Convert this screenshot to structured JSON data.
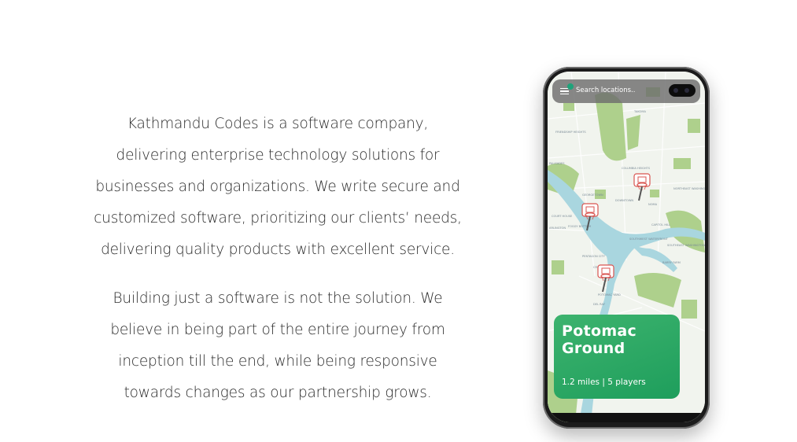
{
  "about": {
    "paragraph_1": "Kathmandu Codes is a software company, delivering enterprise technology solutions for businesses and organizations. We write secure and customized software, prioritizing our clients’ needs, delivering quality products with excellent service.",
    "paragraph_2": "Building just a software is not the solution. We believe in being part of the entire journey from inception till the end, while being responsive towards changes as our partnership grows."
  },
  "phone": {
    "search": {
      "placeholder": "Search locations.."
    },
    "map_labels": [
      "TAKOMA",
      "FRIENDSHIP HEIGHTS",
      "COLUMBIA HEIGHTS",
      "GEORGETOWN",
      "DOWNTOWN",
      "NOMA",
      "COURT HOUSE",
      "FOGGY BOTTOM",
      "CAPITOL HILL",
      "SOUTHWEST WATERFRONT",
      "SOUTHEAST WASHINGTON",
      "BARRY FARM",
      "PENTAGON CITY",
      "CRYSTAL CITY",
      "POTOMAC YARD",
      "DEL RAY",
      "ARLINGTON",
      "PALISADES",
      "NORTHEAST WASHINGTON"
    ],
    "card": {
      "title": "Potomac Ground",
      "meta": "1.2 miles | 5 players"
    }
  },
  "colors": {
    "text": "#2b2b2b",
    "card_green": "#2aa865",
    "river": "#a9d6df",
    "park_green": "#a8cf86",
    "pin_red": "#d9534f"
  },
  "icons": [
    "menu-icon",
    "location-dot-icon",
    "basketball-hoop-icon"
  ]
}
